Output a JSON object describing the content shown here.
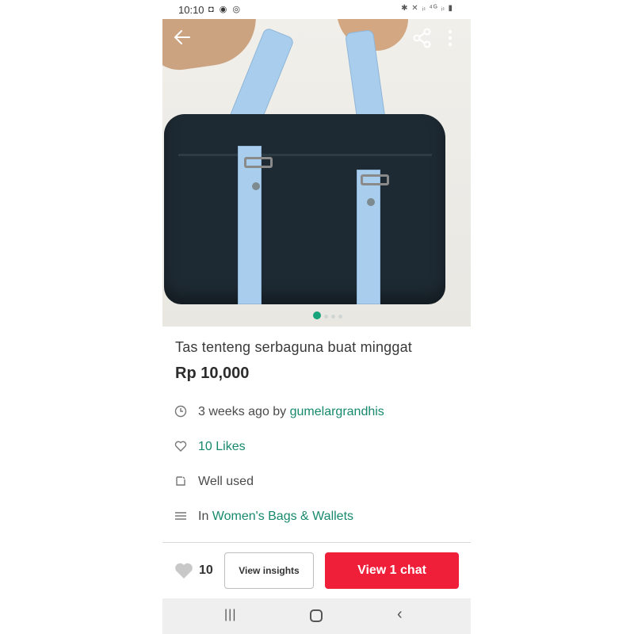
{
  "status": {
    "time": "10:10",
    "left_icons": "◘ ◉ ◎",
    "right_icons": "✱ ✕ ᵢₗ ⁴ᴳ ᵢₗ ▮"
  },
  "listing": {
    "title": "Tas tenteng serbaguna buat minggat",
    "price": "Rp 10,000",
    "posted_prefix": "3 weeks ago by ",
    "seller": "gumelargrandhis",
    "likes": "10 Likes",
    "condition": "Well used",
    "category_prefix": "In ",
    "category": "Women's Bags & Wallets"
  },
  "icons": {
    "back": "arrow-left-icon",
    "share": "share-icon",
    "more": "more-vertical-icon",
    "clock": "clock-icon",
    "heart": "heart-icon",
    "condition": "tag-icon",
    "category": "list-icon"
  },
  "bottom_bar": {
    "like_count": "10",
    "insights_label": "View insights",
    "chat_label": "View 1 chat"
  },
  "colors": {
    "accent_green": "#17896d",
    "chat_red": "#ef1f3a"
  }
}
